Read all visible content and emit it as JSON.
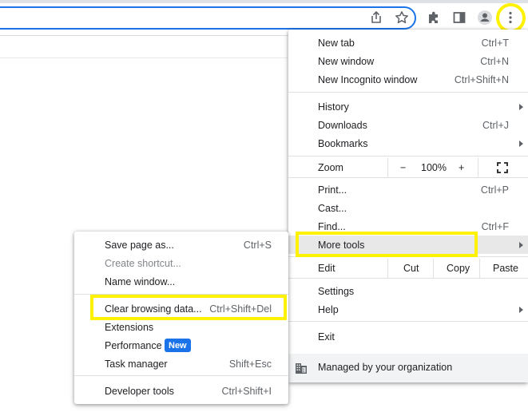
{
  "colors": {
    "highlight": "#fff200",
    "accent": "#1a73e8",
    "hover": "#e8e8e9"
  },
  "toolbar": {
    "icons": [
      "share-icon",
      "bookmark-star-icon",
      "extensions-icon",
      "side-panel-icon",
      "profile-icon",
      "more-menu-icon"
    ]
  },
  "menu": {
    "new_tab": {
      "label": "New tab",
      "shortcut": "Ctrl+T"
    },
    "new_window": {
      "label": "New window",
      "shortcut": "Ctrl+N"
    },
    "new_incognito": {
      "label": "New Incognito window",
      "shortcut": "Ctrl+Shift+N"
    },
    "history": {
      "label": "History"
    },
    "downloads": {
      "label": "Downloads",
      "shortcut": "Ctrl+J"
    },
    "bookmarks": {
      "label": "Bookmarks"
    },
    "zoom": {
      "label": "Zoom",
      "minus": "−",
      "level": "100%",
      "plus": "+"
    },
    "print": {
      "label": "Print...",
      "shortcut": "Ctrl+P"
    },
    "cast": {
      "label": "Cast..."
    },
    "find": {
      "label": "Find...",
      "shortcut": "Ctrl+F"
    },
    "more_tools": {
      "label": "More tools"
    },
    "edit": {
      "label": "Edit",
      "cut": "Cut",
      "copy": "Copy",
      "paste": "Paste"
    },
    "settings": {
      "label": "Settings"
    },
    "help": {
      "label": "Help"
    },
    "exit": {
      "label": "Exit"
    },
    "managed": {
      "label": "Managed by your organization"
    }
  },
  "submenu": {
    "save_page": {
      "label": "Save page as...",
      "shortcut": "Ctrl+S"
    },
    "create_shortcut": {
      "label": "Create shortcut..."
    },
    "name_window": {
      "label": "Name window..."
    },
    "clear_browsing": {
      "label": "Clear browsing data...",
      "shortcut": "Ctrl+Shift+Del"
    },
    "extensions": {
      "label": "Extensions"
    },
    "performance": {
      "label": "Performance",
      "badge": "New"
    },
    "task_manager": {
      "label": "Task manager",
      "shortcut": "Shift+Esc"
    },
    "developer_tools": {
      "label": "Developer tools",
      "shortcut": "Ctrl+Shift+I"
    }
  }
}
